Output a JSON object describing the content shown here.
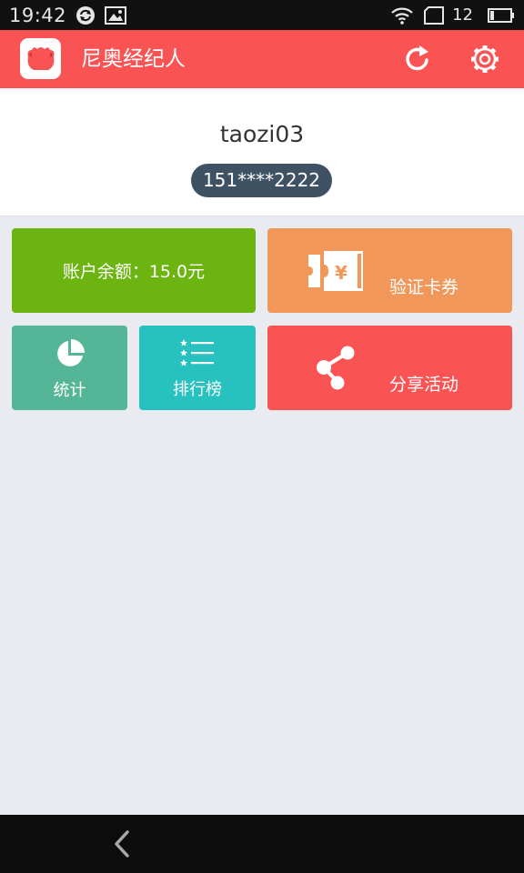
{
  "status_bar": {
    "time": "19:42",
    "battery_level": "12",
    "icons": [
      "sync-icon",
      "image-icon",
      "wifi-icon",
      "sim-icon",
      "battery-icon"
    ]
  },
  "app_bar": {
    "title": "尼奥经纪人",
    "accent_color": "#fa5354",
    "icons": [
      "app-logo-icon",
      "refresh-icon",
      "settings-icon"
    ]
  },
  "profile": {
    "username": "taozi03",
    "phone": "151****2222"
  },
  "tiles": {
    "balance": {
      "label": "账户余额：15.0元",
      "color": "#6cb511"
    },
    "coupon": {
      "label": "验证卡券",
      "icon": "ticket-yen-icon",
      "color": "#f2975a"
    },
    "stats": {
      "label": "统计",
      "icon": "pie-chart-icon",
      "color": "#54b697"
    },
    "ranking": {
      "label": "排行榜",
      "icon": "ranked-list-icon",
      "color": "#27c1bf"
    },
    "share": {
      "label": "分享活动",
      "icon": "share-icon",
      "color": "#fa5354"
    }
  },
  "nav_bar": {
    "icons": [
      "back-icon"
    ]
  }
}
